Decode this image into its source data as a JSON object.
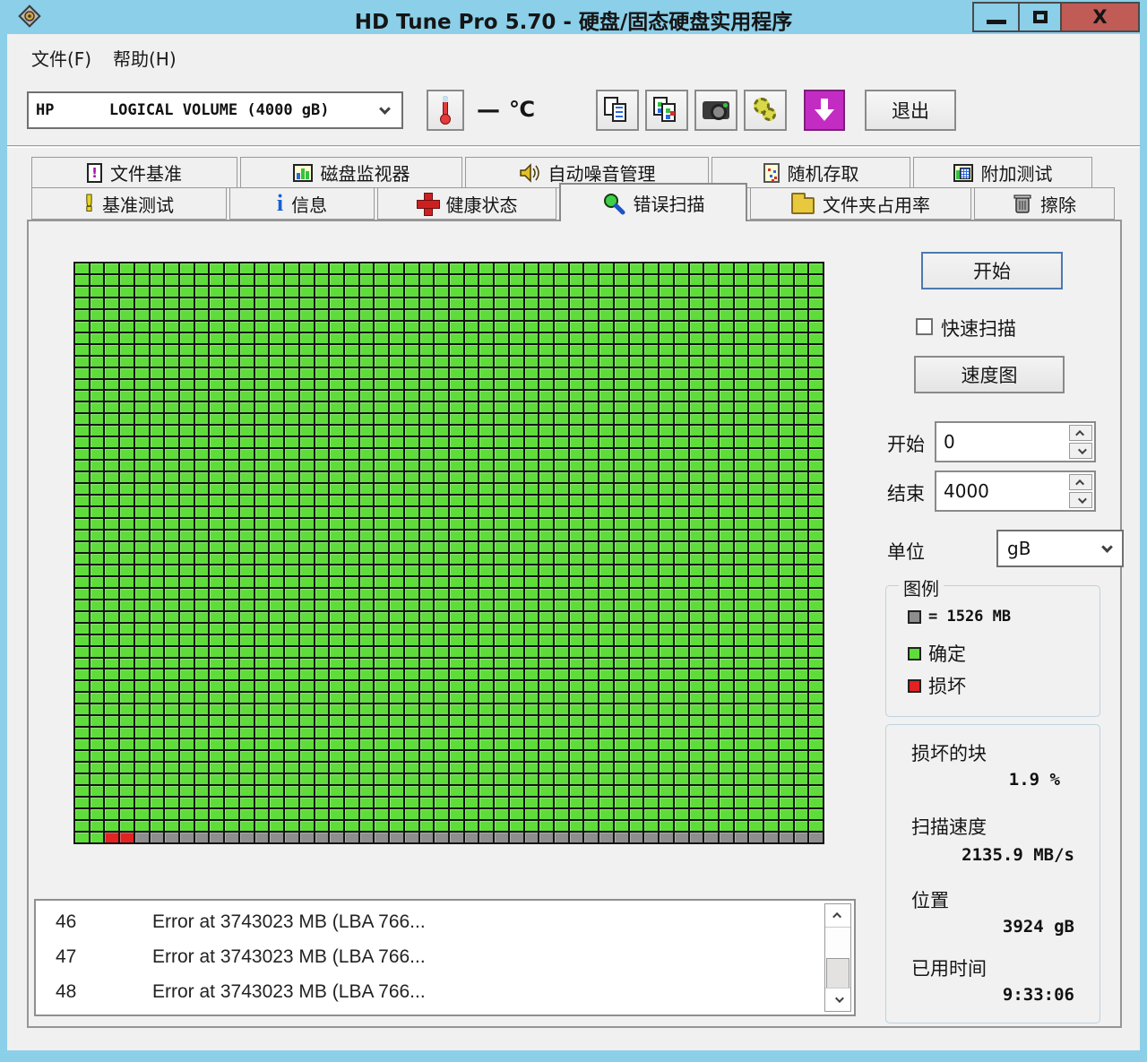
{
  "window": {
    "title": "HD Tune Pro 5.70 - 硬盘/固态硬盘实用程序",
    "close_glyph": "X"
  },
  "menu": {
    "file": "文件(F)",
    "help": "帮助(H)"
  },
  "toolbar": {
    "drive_selected": "HP      LOGICAL VOLUME (4000 gB)",
    "temp_dash": "—",
    "temp_unit": "℃",
    "exit_label": "退出"
  },
  "tabs": {
    "active": "错误扫描",
    "row1": [
      {
        "label": "文件基准"
      },
      {
        "label": "磁盘监视器"
      },
      {
        "label": "自动噪音管理"
      },
      {
        "label": "随机存取"
      },
      {
        "label": "附加测试"
      }
    ],
    "row2": [
      {
        "label": "基准测试"
      },
      {
        "label": "信息"
      },
      {
        "label": "健康状态"
      },
      {
        "label": "错误扫描"
      },
      {
        "label": "文件夹占用率"
      },
      {
        "label": "擦除"
      }
    ],
    "row1_icon_excl": "!",
    "row2_icon_info": "i",
    "row2_icon_excl": "!"
  },
  "scan_controls": {
    "start_button": "开始",
    "quick_scan_label": "快速扫描",
    "speed_map_button": "速度图",
    "start_label": "开始",
    "start_value": "0",
    "end_label": "结束",
    "end_value": "4000",
    "unit_label": "单位",
    "unit_value": "gB"
  },
  "legend": {
    "title": "图例",
    "block_size": "= 1526 MB",
    "ok_label": "确定",
    "damaged_label": "损坏"
  },
  "status": {
    "damaged_blocks_label": "损坏的块",
    "damaged_blocks_value": "1.9 %",
    "scan_speed_label": "扫描速度",
    "scan_speed_value": "2135.9 MB/s",
    "position_label": "位置",
    "position_value": "3924 gB",
    "elapsed_label": "已用时间",
    "elapsed_value": "9:33:06"
  },
  "error_list": [
    {
      "index": "46",
      "message": "Error at 3743023 MB (LBA 766..."
    },
    {
      "index": "47",
      "message": "Error at 3743023 MB (LBA 766..."
    },
    {
      "index": "48",
      "message": "Error at 3743023 MB (LBA 766..."
    }
  ],
  "block_map": {
    "rows": 50,
    "cols": 50,
    "default_state": "ok",
    "last_row": [
      {
        "state": "ok",
        "count": 2
      },
      {
        "state": "bad",
        "count": 2
      },
      {
        "state": "unscanned",
        "count": 46
      }
    ],
    "colors": {
      "ok": "#5edd3a",
      "bad": "#e32222",
      "unscanned": "#8e8e8e"
    }
  }
}
